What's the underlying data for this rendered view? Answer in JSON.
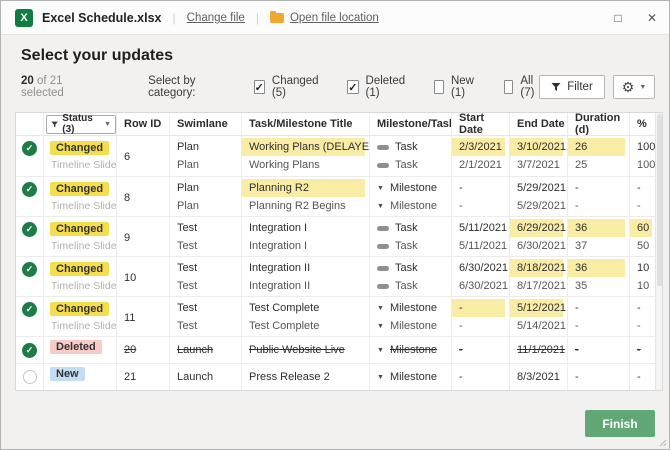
{
  "topbar": {
    "title": "Excel Schedule.xlsx",
    "change_file_label": "Change file",
    "open_file_location_label": "Open file location",
    "maximize_icon": "□",
    "close_icon": "✕"
  },
  "header": {
    "title": "Select your updates",
    "selected_count": "20",
    "selected_suffix": " of 21 selected",
    "category_label": "Select by category:",
    "categories": [
      {
        "label": "Changed (5)",
        "checked": true
      },
      {
        "label": "Deleted (1)",
        "checked": true
      },
      {
        "label": "New (1)",
        "checked": false
      },
      {
        "label": "All (7)",
        "checked": false
      }
    ],
    "filter_label": "Filter"
  },
  "table": {
    "status_filter_label": "Status (3)",
    "columns": [
      "",
      "Status (3)",
      "Row ID",
      "Swimlane",
      "Task/Milestone Title",
      "Milestone/Task",
      "Start Date",
      "End Date",
      "Duration (d)",
      "%"
    ],
    "rows": [
      {
        "status": "Changed",
        "substatus": "Timeline Slide",
        "badge": "changed",
        "selected": true,
        "struck": false,
        "row_id": "6",
        "lines": [
          {
            "swimlane": "Plan",
            "title": "Working Plans (DELAYED)",
            "title_hl": true,
            "kind": "task",
            "kind_label": "Task",
            "start": "2/3/2021",
            "start_hl": true,
            "end": "3/10/2021",
            "end_hl": true,
            "dur": "26",
            "dur_hl": true,
            "pct": "100",
            "pct_hl": false
          },
          {
            "swimlane": "Plan",
            "title": "Working Plans",
            "title_hl": false,
            "kind": "task",
            "kind_label": "Task",
            "start": "2/1/2021",
            "start_hl": false,
            "end": "3/7/2021",
            "end_hl": false,
            "dur": "25",
            "dur_hl": false,
            "pct": "100",
            "pct_hl": false
          }
        ]
      },
      {
        "status": "Changed",
        "substatus": "Timeline Slide",
        "badge": "changed",
        "selected": true,
        "struck": false,
        "row_id": "8",
        "lines": [
          {
            "swimlane": "Plan",
            "title": "Planning R2",
            "title_hl": true,
            "kind": "milestone",
            "kind_label": "Milestone",
            "start": "-",
            "start_hl": false,
            "end": "5/29/2021",
            "end_hl": false,
            "dur": "-",
            "dur_hl": false,
            "pct": "-",
            "pct_hl": false
          },
          {
            "swimlane": "Plan",
            "title": "Planning R2 Begins",
            "title_hl": false,
            "kind": "milestone",
            "kind_label": "Milestone",
            "start": "-",
            "start_hl": false,
            "end": "5/29/2021",
            "end_hl": false,
            "dur": "-",
            "dur_hl": false,
            "pct": "-",
            "pct_hl": false
          }
        ]
      },
      {
        "status": "Changed",
        "substatus": "Timeline Slide",
        "badge": "changed",
        "selected": true,
        "struck": false,
        "row_id": "9",
        "lines": [
          {
            "swimlane": "Test",
            "title": "Integration I",
            "title_hl": false,
            "kind": "task",
            "kind_label": "Task",
            "start": "5/11/2021",
            "start_hl": false,
            "end": "6/29/2021",
            "end_hl": true,
            "dur": "36",
            "dur_hl": true,
            "pct": "60",
            "pct_hl": true
          },
          {
            "swimlane": "Test",
            "title": "Integration I",
            "title_hl": false,
            "kind": "task",
            "kind_label": "Task",
            "start": "5/11/2021",
            "start_hl": false,
            "end": "6/30/2021",
            "end_hl": false,
            "dur": "37",
            "dur_hl": false,
            "pct": "50",
            "pct_hl": false
          }
        ]
      },
      {
        "status": "Changed",
        "substatus": "Timeline Slide",
        "badge": "changed",
        "selected": true,
        "struck": false,
        "row_id": "10",
        "lines": [
          {
            "swimlane": "Test",
            "title": "Integration II",
            "title_hl": false,
            "kind": "task",
            "kind_label": "Task",
            "start": "6/30/2021",
            "start_hl": false,
            "end": "8/18/2021",
            "end_hl": true,
            "dur": "36",
            "dur_hl": true,
            "pct": "10",
            "pct_hl": false
          },
          {
            "swimlane": "Test",
            "title": "Integration II",
            "title_hl": false,
            "kind": "task",
            "kind_label": "Task",
            "start": "6/30/2021",
            "start_hl": false,
            "end": "8/17/2021",
            "end_hl": false,
            "dur": "35",
            "dur_hl": false,
            "pct": "10",
            "pct_hl": false
          }
        ]
      },
      {
        "status": "Changed",
        "substatus": "Timeline Slide",
        "badge": "changed",
        "selected": true,
        "struck": false,
        "row_id": "11",
        "lines": [
          {
            "swimlane": "Test",
            "title": "Test Complete",
            "title_hl": false,
            "kind": "milestone",
            "kind_label": "Milestone",
            "start": "-",
            "start_hl": true,
            "end": "5/12/2021",
            "end_hl": true,
            "dur": "-",
            "dur_hl": false,
            "pct": "-",
            "pct_hl": false
          },
          {
            "swimlane": "Test",
            "title": "Test Complete",
            "title_hl": false,
            "kind": "milestone",
            "kind_label": "Milestone",
            "start": "-",
            "start_hl": false,
            "end": "5/14/2021",
            "end_hl": false,
            "dur": "-",
            "dur_hl": false,
            "pct": "-",
            "pct_hl": false
          }
        ]
      },
      {
        "status": "Deleted",
        "substatus": "",
        "badge": "deleted",
        "selected": true,
        "struck": true,
        "row_id": "20",
        "lines": [
          {
            "swimlane": "Launch",
            "title": "Public Website Live",
            "title_hl": false,
            "kind": "milestone",
            "kind_label": "Milestone",
            "start": "-",
            "start_hl": false,
            "end": "11/1/2021",
            "end_hl": false,
            "dur": "-",
            "dur_hl": false,
            "pct": "-",
            "pct_hl": false
          }
        ]
      },
      {
        "status": "New",
        "substatus": "",
        "badge": "new",
        "selected": false,
        "struck": false,
        "row_id": "21",
        "lines": [
          {
            "swimlane": "Launch",
            "title": "Press Release 2",
            "title_hl": false,
            "kind": "milestone",
            "kind_label": "Milestone",
            "start": "-",
            "start_hl": false,
            "end": "8/3/2021",
            "end_hl": false,
            "dur": "-",
            "dur_hl": false,
            "pct": "-",
            "pct_hl": false
          }
        ]
      }
    ]
  },
  "footer": {
    "finish_label": "Finish"
  },
  "colors": {
    "accent_green": "#1E7C45",
    "finish_button_green": "#62A877",
    "badge_changed_yellow": "#F5DE4E",
    "badge_deleted_pink": "#F8CBC6",
    "badge_new_blue": "#C5DCF5",
    "highlight_yellow": "#F9EDA6",
    "excel_icon_green": "#107C41",
    "folder_icon_yellow": "#F0A830"
  }
}
